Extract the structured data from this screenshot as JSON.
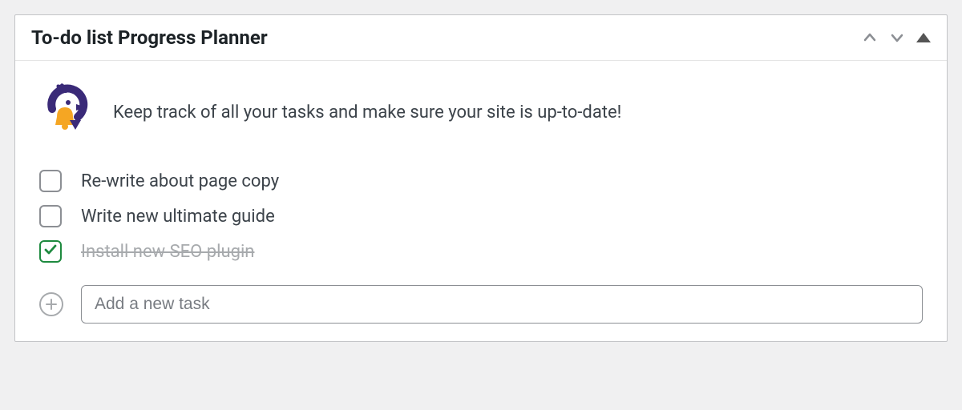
{
  "panel": {
    "title": "To-do list Progress Planner",
    "intro": "Keep track of all your tasks and make sure your site is up-to-date!"
  },
  "tasks": [
    {
      "label": "Re-write about page copy",
      "done": false
    },
    {
      "label": "Write new ultimate guide",
      "done": false
    },
    {
      "label": "Install new SEO plugin",
      "done": true
    }
  ],
  "addTask": {
    "placeholder": "Add a new task"
  }
}
